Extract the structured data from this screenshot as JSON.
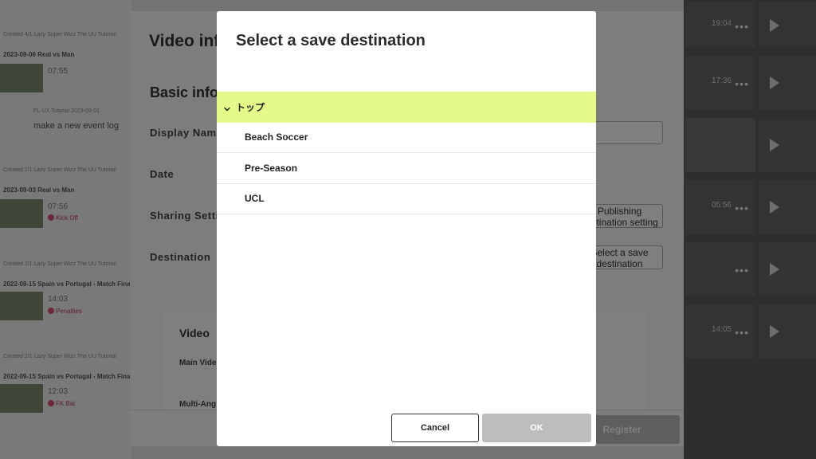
{
  "background": {
    "feed": [
      {
        "meta": "Created 4/1 Lazy Super Wizz The UU Tutorial",
        "title": "2023-09-06 Real vs Man",
        "time": "07:55",
        "badge": ""
      },
      {
        "meta": "FL-UX Tutorial 2023-09-01",
        "title": "make a new event log",
        "time": "",
        "badge": ""
      },
      {
        "meta": "Created 2/1 Lazy Super Wizz The UU Tutorial",
        "title": "2023-09-03 Real vs Man",
        "time": "07:56",
        "badge": "Kick Off"
      },
      {
        "meta": "Created 2/1 Lazy Super Wizz The UU Tutorial",
        "title": "2022-09-15 Spain vs Portugal - Match Final",
        "time": "14:03",
        "badge": "Penalties"
      },
      {
        "meta": "Created 2/1 Lazy Super Wizz The UU Tutorial",
        "title": "2022-09-15 Spain vs Portugal - Match Final",
        "time": "12:03",
        "badge": "FK Bal"
      }
    ],
    "grid": [
      {
        "time": "19:04",
        "has_play": false
      },
      {
        "time": "",
        "has_play": true
      },
      {
        "time": "17:36",
        "has_play": false
      },
      {
        "time": "",
        "has_play": true
      },
      {
        "time": "05:56",
        "has_play": false
      },
      {
        "time": "",
        "has_play": true
      },
      {
        "time": "",
        "has_play": false
      },
      {
        "time": "",
        "has_play": true
      },
      {
        "time": "14:05",
        "has_play": false
      },
      {
        "time": "",
        "has_play": true
      }
    ],
    "form": {
      "title": "Video inf",
      "section": "Basic info",
      "labels": {
        "display_name": "Display Nam",
        "date": "Date",
        "sharing": "Sharing Setti",
        "destination": "Destination"
      },
      "publishing_button": "Publishing destination setting",
      "select_dest_button": "Select a save destination",
      "card_title": "Video",
      "card_label_main": "Main Vide",
      "card_label_multi": "Multi-Ang",
      "register": "Register"
    }
  },
  "modal": {
    "title": "Select a save destination",
    "root": {
      "label": "トップ",
      "expanded": true
    },
    "children": [
      {
        "label": "Beach Soccer"
      },
      {
        "label": "Pre-Season"
      },
      {
        "label": "UCL"
      }
    ],
    "cancel_label": "Cancel",
    "ok_label": "OK"
  },
  "colors": {
    "selected_highlight": "#e4fb8a",
    "ok_disabled": "#bdbdbd",
    "overlay": "#000000"
  }
}
